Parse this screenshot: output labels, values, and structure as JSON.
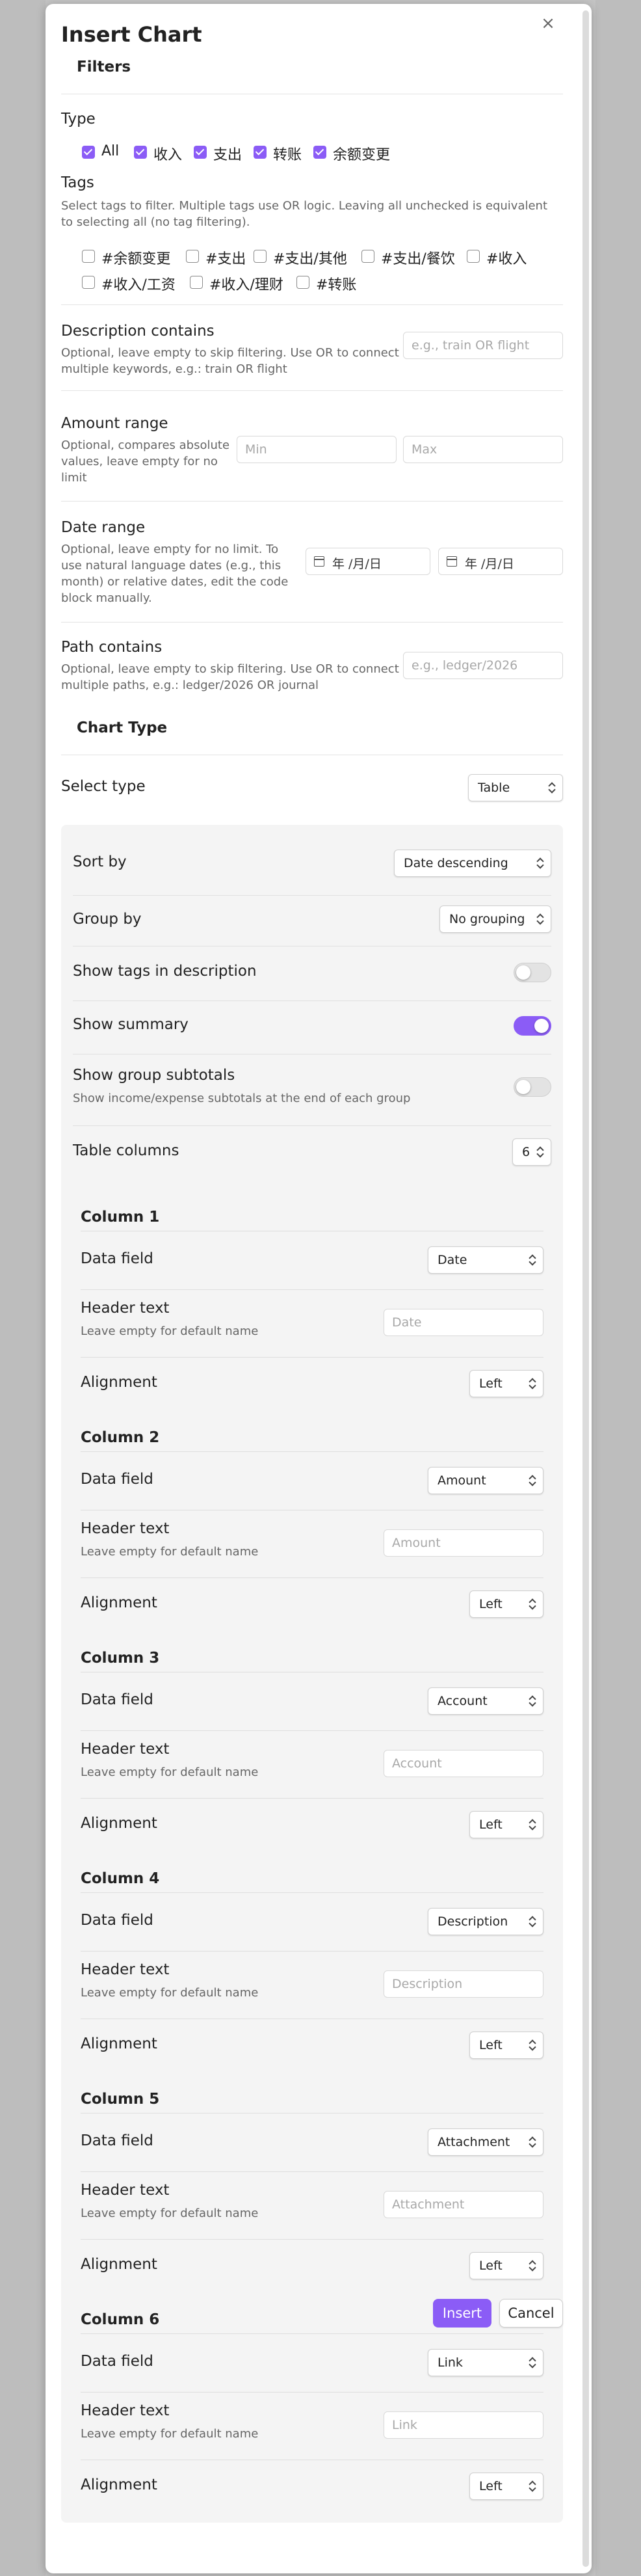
{
  "dialog": {
    "title": "Insert Chart",
    "close_label": "×"
  },
  "filters": {
    "heading": "Filters",
    "type": {
      "label": "Type",
      "options": [
        {
          "label": "All",
          "checked": true
        },
        {
          "label": "收入",
          "checked": true
        },
        {
          "label": "支出",
          "checked": true
        },
        {
          "label": "转账",
          "checked": true
        },
        {
          "label": "余额变更",
          "checked": true
        }
      ]
    },
    "tags": {
      "label": "Tags",
      "description": "Select tags to filter. Multiple tags use OR logic. Leaving all unchecked is equivalent to selecting all (no tag filtering).",
      "options": [
        {
          "label": "#余额变更",
          "checked": false
        },
        {
          "label": "#支出",
          "checked": false
        },
        {
          "label": "#支出/其他",
          "checked": false
        },
        {
          "label": "#支出/餐饮",
          "checked": false
        },
        {
          "label": "#收入",
          "checked": false
        },
        {
          "label": "#收入/工资",
          "checked": false
        },
        {
          "label": "#收入/理财",
          "checked": false
        },
        {
          "label": "#转账",
          "checked": false
        }
      ]
    },
    "description_contains": {
      "label": "Description contains",
      "description": "Optional, leave empty to skip filtering. Use OR to connect multiple keywords, e.g.: train OR flight",
      "value": "",
      "placeholder": "e.g., train OR flight"
    },
    "amount_range": {
      "label": "Amount range",
      "description": "Optional, compares absolute values, leave empty for no limit",
      "min_placeholder": "Min",
      "max_placeholder": "Max"
    },
    "date_range": {
      "label": "Date range",
      "description": "Optional, leave empty for no limit. To use natural language dates (e.g., this month) or relative dates, edit the code block manually.",
      "start_display": "年 /月/日",
      "end_display": "年 /月/日"
    },
    "path_contains": {
      "label": "Path contains",
      "description": "Optional, leave empty to skip filtering. Use OR to connect multiple paths, e.g.: ledger/2026 OR journal",
      "placeholder": "e.g., ledger/2026"
    }
  },
  "chart_type": {
    "heading": "Chart Type",
    "select_type": {
      "label": "Select type",
      "value": "Table"
    }
  },
  "table_settings": {
    "sort_by": {
      "label": "Sort by",
      "value": "Date descending"
    },
    "group_by": {
      "label": "Group by",
      "value": "No grouping"
    },
    "show_tags": {
      "label": "Show tags in description",
      "on": false
    },
    "show_summary": {
      "label": "Show summary",
      "on": true
    },
    "show_group_subtotals": {
      "label": "Show group subtotals",
      "description": "Show income/expense subtotals at the end of each group",
      "on": false
    },
    "table_columns": {
      "label": "Table columns",
      "value": "6"
    }
  },
  "columns": [
    {
      "heading": "Column 1",
      "field_label": "Data field",
      "field": "Date",
      "header_label": "Header text",
      "header_hint": "Leave empty for default name",
      "header_placeholder": "Date",
      "align_label": "Alignment",
      "alignment": "Left"
    },
    {
      "heading": "Column 2",
      "field_label": "Data field",
      "field": "Amount",
      "header_label": "Header text",
      "header_hint": "Leave empty for default name",
      "header_placeholder": "Amount",
      "align_label": "Alignment",
      "alignment": "Left"
    },
    {
      "heading": "Column 3",
      "field_label": "Data field",
      "field": "Account",
      "header_label": "Header text",
      "header_hint": "Leave empty for default name",
      "header_placeholder": "Account",
      "align_label": "Alignment",
      "alignment": "Left"
    },
    {
      "heading": "Column 4",
      "field_label": "Data field",
      "field": "Description",
      "header_label": "Header text",
      "header_hint": "Leave empty for default name",
      "header_placeholder": "Description",
      "align_label": "Alignment",
      "alignment": "Left"
    },
    {
      "heading": "Column 5",
      "field_label": "Data field",
      "field": "Attachment",
      "header_label": "Header text",
      "header_hint": "Leave empty for default name",
      "header_placeholder": "Attachment",
      "align_label": "Alignment",
      "alignment": "Left"
    },
    {
      "heading": "Column 6",
      "field_label": "Data field",
      "field": "Link",
      "header_label": "Header text",
      "header_hint": "Leave empty for default name",
      "header_placeholder": "Link",
      "align_label": "Alignment",
      "alignment": "Left"
    }
  ],
  "footer": {
    "insert_label": "Insert",
    "cancel_label": "Cancel"
  },
  "colors": {
    "accent": "#8b5cf6",
    "background": "#c4c4c4",
    "panel": "#f4f4f4"
  }
}
